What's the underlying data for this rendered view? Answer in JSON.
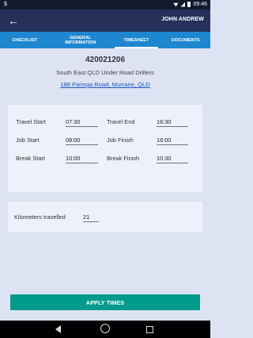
{
  "status_bar": {
    "left_label": "$",
    "time": "09:46"
  },
  "app_bar": {
    "user_name": "JOHN ANDREW"
  },
  "tabs": [
    {
      "label": "CHECKLIST",
      "active": false
    },
    {
      "label": "GENERAL INFORMATION",
      "active": false
    },
    {
      "label": "TIMESHEET",
      "active": true
    },
    {
      "label": "DOCUMENTS",
      "active": false
    }
  ],
  "job": {
    "number": "420021206",
    "client": "South East QLD Under Road Drillers",
    "address": "188 Paringa Road, Murrarie, QLD"
  },
  "timesheet": {
    "travel_start": {
      "label": "Travel Start",
      "value": "07:30"
    },
    "travel_end": {
      "label": "Travel End",
      "value": "16:30"
    },
    "job_start": {
      "label": "Job Start",
      "value": "08:00"
    },
    "job_finish": {
      "label": "Job Finish",
      "value": "16:00"
    },
    "break_start": {
      "label": "Break Start",
      "value": "10:00"
    },
    "break_finish": {
      "label": "Break Finish",
      "value": "10:30"
    }
  },
  "kilometers": {
    "label": "Kilometers travelled",
    "value": "21"
  },
  "apply_button": {
    "label": "APPLY TIMES"
  },
  "colors": {
    "app_bar": "#263159",
    "tab_bar": "#1f87cf",
    "apply": "#009b8a",
    "link": "#1a56c8"
  }
}
